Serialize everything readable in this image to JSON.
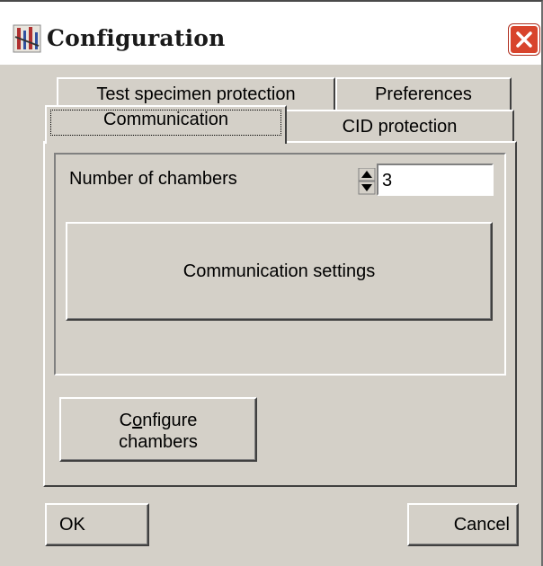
{
  "window": {
    "title": "Configuration",
    "icon": "app-config-icon",
    "close_icon": "close-icon"
  },
  "tabs": {
    "row_back": [
      "Test specimen protection",
      "Preferences"
    ],
    "row_front": [
      "Communication",
      "CID protection"
    ],
    "active": "Communication"
  },
  "communication": {
    "chambers_label": "Number of chambers",
    "chambers_value": "3",
    "settings_button": "Communication settings"
  },
  "configure_button": {
    "line1_pre": "C",
    "line1_ul": "o",
    "line1_post": "nfigure",
    "line2": "chambers"
  },
  "footer": {
    "ok": "OK",
    "cancel": "Cancel"
  },
  "colors": {
    "face": "#d4d0c8",
    "close_red": "#d8442c"
  }
}
